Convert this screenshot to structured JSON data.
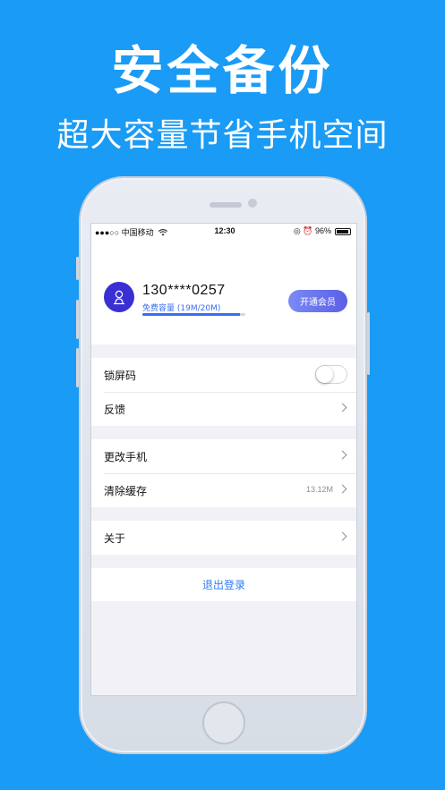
{
  "banner": {
    "title": "安全备份",
    "subtitle": "超大容量节省手机空间"
  },
  "statusbar": {
    "carrier": "●●●○○ 中国移动",
    "wifi_icon": "wifi-icon",
    "time": "12:30",
    "right": "◎ ⏰ 96%",
    "battery_icon": "battery-icon"
  },
  "profile": {
    "phone": "130****0257",
    "storage_label": "免费容量 (19M/20M)",
    "storage_fraction": 0.95,
    "vip_button": "开通会员",
    "avatar_icon": "user-icon"
  },
  "settings": {
    "lock_label": "锁屏码",
    "lock_enabled": false,
    "feedback_label": "反馈",
    "change_phone_label": "更改手机",
    "clear_cache_label": "清除缓存",
    "cache_size": "13.12M",
    "about_label": "关于"
  },
  "logout_label": "退出登录",
  "colors": {
    "background": "#1a9bf5",
    "accent": "#3a6df0",
    "avatar": "#3a2fd3",
    "link": "#2f7cf6"
  }
}
